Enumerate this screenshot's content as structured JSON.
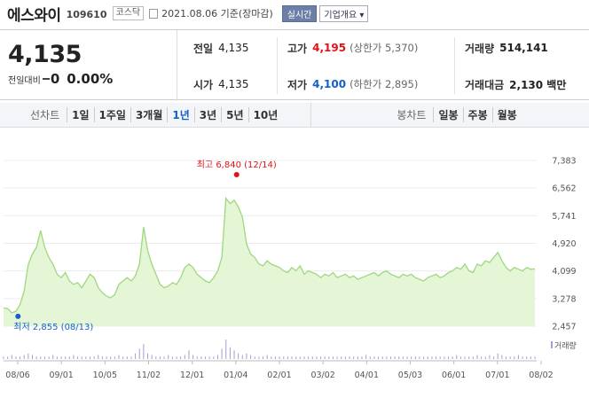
{
  "header": {
    "name": "에스와이",
    "code": "109610",
    "market": "코스닥",
    "date": "2021.08.06 기준(장마감)",
    "realtime": "실시간",
    "company_info": "기업개요 ▾"
  },
  "quote": {
    "price": "4,135",
    "change_label": "전일대비",
    "change_value": "0",
    "change_pct": "0.00%",
    "prev_label": "전일",
    "prev": "4,135",
    "open_label": "시가",
    "open": "4,135",
    "high_label": "고가",
    "high": "4,195",
    "upper_limit": "(상한가 5,370)",
    "low_label": "저가",
    "low": "4,100",
    "lower_limit": "(하한가 2,895)",
    "volume_label": "거래량",
    "volume": "514,141",
    "amount_label": "거래대금",
    "amount": "2,130 백만"
  },
  "tabs": {
    "line_label": "선차트",
    "line_items": [
      "1일",
      "1주일",
      "3개월",
      "1년",
      "3년",
      "5년",
      "10년"
    ],
    "active": "1년",
    "candle_label": "봉차트",
    "candle_items": [
      "일봉",
      "주봉",
      "월봉"
    ]
  },
  "chart_data": {
    "type": "area",
    "x_tick_labels": [
      "08/06",
      "09/01",
      "10/05",
      "11/02",
      "12/01",
      "01/04",
      "02/01",
      "03/02",
      "04/01",
      "05/03",
      "06/01",
      "07/01",
      "08/02"
    ],
    "y_tick_labels": [
      "7,383",
      "6,562",
      "5,741",
      "4,920",
      "4,099",
      "3,278",
      "2,457"
    ],
    "ylim": [
      2457,
      7383
    ],
    "series": [
      {
        "values": [
          3000,
          2980,
          2855,
          2900,
          3100,
          3500,
          4300,
          4600,
          4800,
          5300,
          4800,
          4500,
          4300,
          4000,
          3900,
          4050,
          3800,
          3700,
          3750,
          3600,
          3800,
          4000,
          3900,
          3600,
          3450,
          3350,
          3300,
          3400,
          3700,
          3800,
          3900,
          3800,
          3950,
          4300,
          5400,
          4700,
          4300,
          4000,
          3700,
          3600,
          3650,
          3750,
          3700,
          3900,
          4200,
          4300,
          4200,
          4000,
          3900,
          3800,
          3750,
          3900,
          4100,
          4500,
          6260,
          6100,
          6200,
          6000,
          5700,
          4900,
          4600,
          4500,
          4300,
          4250,
          4400,
          4300,
          4250,
          4200,
          4100,
          4050,
          4200,
          4100,
          4250,
          4000,
          4100,
          4050,
          4000,
          3900,
          4000,
          3950,
          4050,
          3900,
          3950,
          4000,
          3900,
          3950,
          3850,
          3900,
          3950,
          4000,
          4050,
          3950,
          4050,
          4100,
          4000,
          3950,
          3900,
          4000,
          3950,
          4000,
          3900,
          3850,
          3800,
          3900,
          3950,
          4000,
          3900,
          3950,
          4050,
          4100,
          4200,
          4150,
          4300,
          4100,
          4050,
          4300,
          4250,
          4400,
          4350,
          4500,
          4650,
          4400,
          4200,
          4100,
          4200,
          4150,
          4100,
          4200,
          4150,
          4160
        ]
      }
    ],
    "volume": [
      1,
      1,
      2,
      1,
      1,
      2,
      3,
      2,
      1,
      1,
      1,
      1,
      2,
      1,
      1,
      1,
      1,
      2,
      1,
      1,
      1,
      1,
      1,
      2,
      1,
      1,
      1,
      1,
      2,
      1,
      1,
      1,
      3,
      6,
      9,
      3,
      2,
      1,
      1,
      1,
      2,
      1,
      1,
      1,
      2,
      5,
      2,
      1,
      1,
      1,
      1,
      1,
      2,
      6,
      12,
      7,
      5,
      3,
      2,
      3,
      2,
      1,
      1,
      1,
      2,
      1,
      1,
      1,
      1,
      1,
      1,
      1,
      1,
      1,
      1,
      1,
      1,
      1,
      1,
      1,
      1,
      1,
      1,
      1,
      1,
      1,
      1,
      1,
      2,
      1,
      1,
      1,
      1,
      1,
      1,
      1,
      1,
      1,
      1,
      1,
      1,
      1,
      1,
      1,
      1,
      1,
      1,
      1,
      1,
      1,
      2,
      1,
      1,
      1,
      1,
      2,
      1,
      1,
      2,
      1,
      3,
      2,
      1,
      1,
      1,
      2,
      1,
      1,
      1,
      1
    ],
    "volume_label": "거래량",
    "annotations": {
      "high": "최고 6,840 (12/14)",
      "low": "최저 2,855 (08/13)"
    },
    "colors": {
      "line": "#9ed87e",
      "fill": "#e4f6d6",
      "high": "#e0121b",
      "low": "#1560c8",
      "volume": "#a59bd6"
    }
  }
}
